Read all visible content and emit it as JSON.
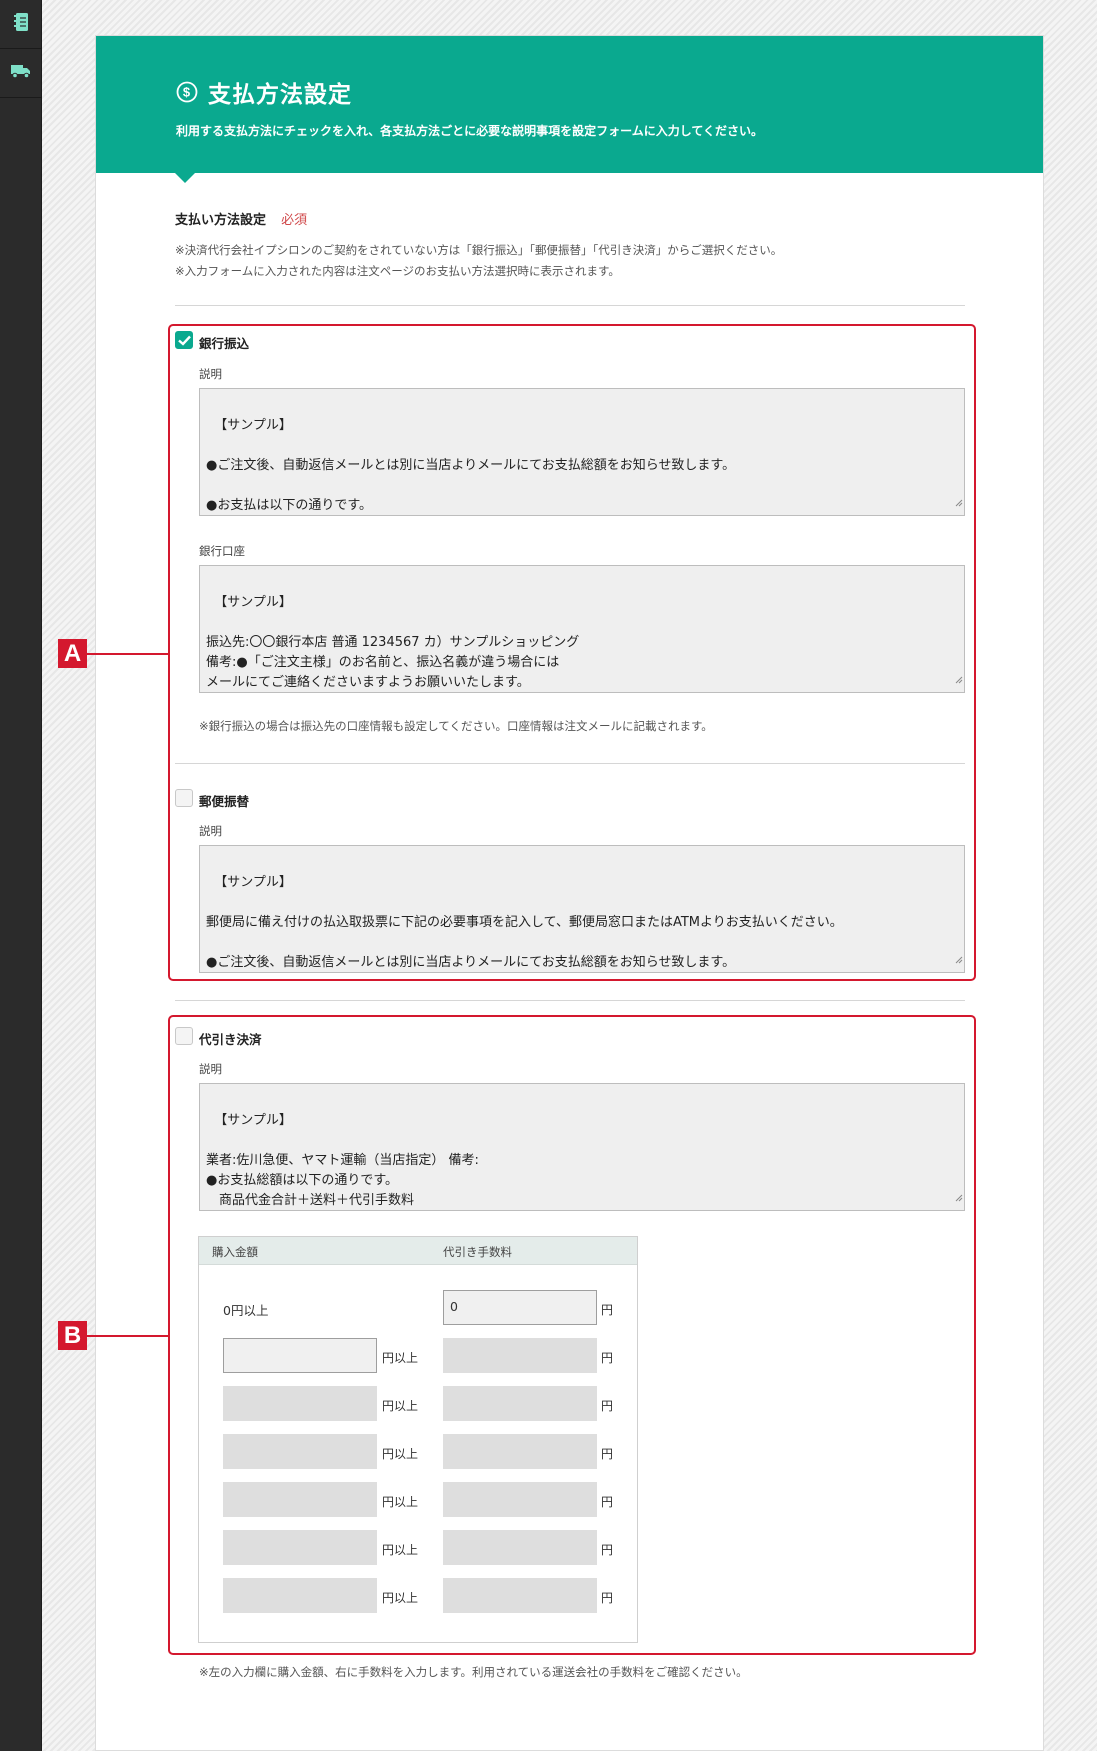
{
  "rail": {
    "icons": [
      "notebook-icon",
      "truck-icon"
    ]
  },
  "header": {
    "title": "支払方法設定",
    "subtitle": "利用する支払方法にチェックを入れ、各支払方法ごとに必要な説明事項を設定フォームに入力してください。"
  },
  "section": {
    "label": "支払い方法設定",
    "required": "必須",
    "notes": [
      "※決済代行会社イプシロンのご契約をされていない方は「銀行振込」「郵便振替」「代引き決済」からご選択ください。",
      "※入力フォームに入力された内容は注文ページのお支払い方法選択時に表示されます。"
    ]
  },
  "markers": {
    "a": "A",
    "b": "B"
  },
  "bank": {
    "label": "銀行振込",
    "checked": true,
    "desc_label": "説明",
    "desc_value": "【サンプル】\n\n●ご注文後、自動返信メールとは別に当店よりメールにてお支払総額をお知らせ致します。\n\n●お支払は以下の通りです。\nお支払金額：（商品代金合計）＋（送料〇〇〇円）＋振込手数料（お客様負担）",
    "account_label": "銀行口座",
    "account_value": "【サンプル】\n\n振込先:〇〇銀行本店 普通 1234567 カ）サンプルショッピング\n備考:●「ご注文主様」のお名前と、振込名義が違う場合には\nメールにてご連絡くださいますようお願いいたします。",
    "note": "※銀行振込の場合は振込先の口座情報も設定してください。口座情報は注文メールに記載されます。"
  },
  "postal": {
    "label": "郵便振替",
    "checked": false,
    "desc_label": "説明",
    "desc_value": "【サンプル】\n\n郵便局に備え付けの払込取扱票に下記の必要事項を記入して、郵便局窓口またはATMよりお支払いください。\n\n●ご注文後、自動返信メールとは別に当店よりメールにてお支払総額をお知らせ致します。"
  },
  "cod": {
    "label": "代引き決済",
    "checked": false,
    "desc_label": "説明",
    "desc_value": "【サンプル】\n\n業者:佐川急便、ヤマト運輸（当店指定） 備考:\n●お支払総額は以下の通りです。\n　商品代金合計＋送料＋代引手数料\n　代引手数料：下表をご参照ください。",
    "table": {
      "col_amount": "購入金額",
      "col_fee": "代引き手数料",
      "first_amount": "0円以上",
      "first_fee": "0",
      "amount_unit": "円以上",
      "fee_unit": "円",
      "rows": [
        {
          "amount": "",
          "fee": ""
        },
        {
          "amount": "",
          "fee": ""
        },
        {
          "amount": "",
          "fee": ""
        },
        {
          "amount": "",
          "fee": ""
        },
        {
          "amount": "",
          "fee": ""
        },
        {
          "amount": "",
          "fee": ""
        }
      ]
    },
    "note": "※左の入力欄に購入金額、右に手数料を入力します。利用されている運送会社の手数料をご確認ください。"
  }
}
